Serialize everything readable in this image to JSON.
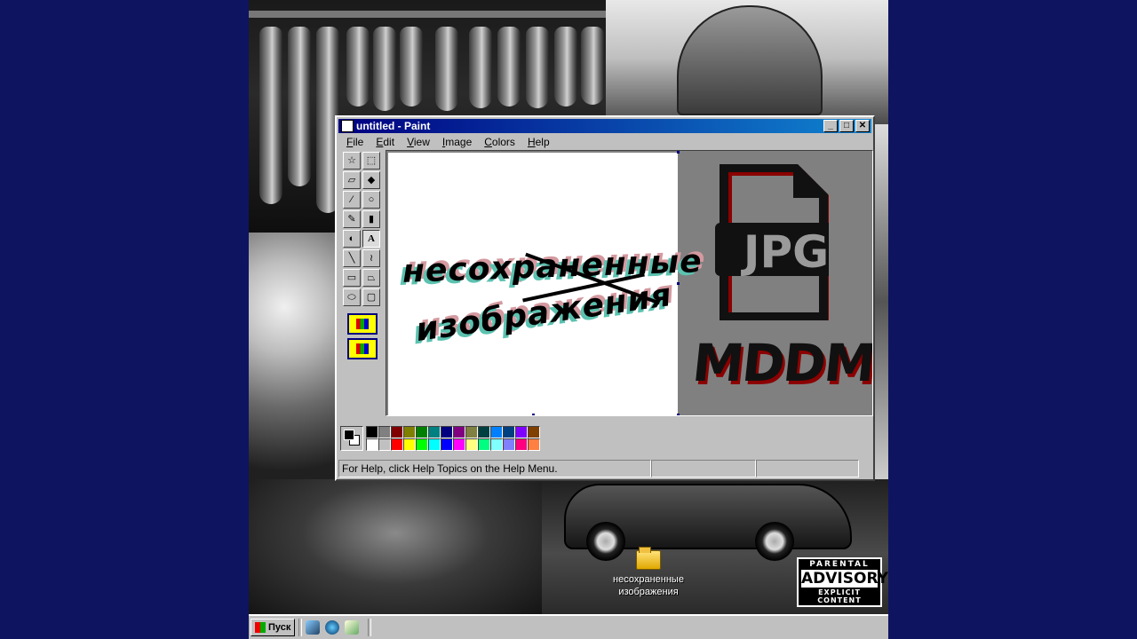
{
  "window": {
    "title": "untitled - Paint",
    "minimize": "_",
    "maximize": "□",
    "close": "✕"
  },
  "menu": [
    "File",
    "Edit",
    "View",
    "Image",
    "Colors",
    "Help"
  ],
  "tools": [
    "free-form-select",
    "select",
    "eraser",
    "fill-with-color",
    "pick-color",
    "magnifier",
    "pencil",
    "brush",
    "airbrush",
    "text",
    "line",
    "curve",
    "rectangle",
    "polygon",
    "ellipse",
    "rounded-rectangle"
  ],
  "canvas": {
    "line1": "несохраненные",
    "line2": "изображения",
    "doc_label": "JPG",
    "artist": "MDDM"
  },
  "palette": {
    "colors": [
      "#000000",
      "#808080",
      "#800000",
      "#808000",
      "#008000",
      "#008080",
      "#000080",
      "#800080",
      "#808040",
      "#004040",
      "#0080ff",
      "#004080",
      "#8000ff",
      "#804000",
      "#ffffff",
      "#c0c0c0",
      "#ff0000",
      "#ffff00",
      "#00ff00",
      "#00ffff",
      "#0000ff",
      "#ff00ff",
      "#ffff80",
      "#00ff80",
      "#80ffff",
      "#8080ff",
      "#ff0080",
      "#ff8040"
    ]
  },
  "status": {
    "help_text": "For Help, click Help Topics on the Help Menu."
  },
  "desktop": {
    "folder_label": "несохраненные изображения"
  },
  "advisory": {
    "line1": "PARENTAL",
    "line2": "ADVISORY",
    "line3": "EXPLICIT CONTENT"
  },
  "taskbar": {
    "start_label": "Пуск"
  }
}
